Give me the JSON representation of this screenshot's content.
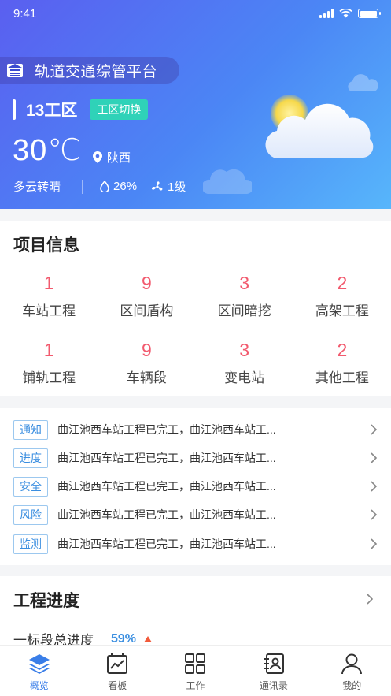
{
  "status_bar": {
    "time": "9:41"
  },
  "header": {
    "platform_title": "轨道交通综管平台",
    "zone_name": "13工区",
    "zone_switch_label": "工区切换",
    "temperature": "30℃",
    "location": "陕西",
    "weather_desc": "多云转晴",
    "humidity": "26%",
    "wind": "1级"
  },
  "project_info": {
    "title": "项目信息",
    "stats": [
      {
        "value": "1",
        "label": "车站工程"
      },
      {
        "value": "9",
        "label": "区间盾构"
      },
      {
        "value": "3",
        "label": "区间暗挖"
      },
      {
        "value": "2",
        "label": "高架工程"
      },
      {
        "value": "1",
        "label": "铺轨工程"
      },
      {
        "value": "9",
        "label": "车辆段"
      },
      {
        "value": "3",
        "label": "变电站"
      },
      {
        "value": "2",
        "label": "其他工程"
      }
    ]
  },
  "notices": [
    {
      "tag": "通知",
      "text": "曲江池西车站工程已完工，曲江池西车站工..."
    },
    {
      "tag": "进度",
      "text": "曲江池西车站工程已完工，曲江池西车站工..."
    },
    {
      "tag": "安全",
      "text": "曲江池西车站工程已完工，曲江池西车站工..."
    },
    {
      "tag": "风险",
      "text": "曲江池西车站工程已完工，曲江池西车站工..."
    },
    {
      "tag": "监测",
      "text": "曲江池西车站工程已完工，曲江池西车站工..."
    }
  ],
  "progress": {
    "title": "工程进度",
    "item_label": "一标段总进度",
    "item_value": "59%"
  },
  "tabbar": {
    "items": [
      {
        "label": "概览",
        "icon": "layers-icon",
        "active": true
      },
      {
        "label": "看板",
        "icon": "chart-board-icon",
        "active": false
      },
      {
        "label": "工作",
        "icon": "grid-apps-icon",
        "active": false
      },
      {
        "label": "通讯录",
        "icon": "contacts-icon",
        "active": false
      },
      {
        "label": "我的",
        "icon": "user-icon",
        "active": false
      }
    ]
  },
  "colors": {
    "accent_blue": "#3a7ee8",
    "stat_red": "#f25a6e",
    "switch_teal": "#2fd2b8",
    "trend_up": "#f25a3a"
  }
}
